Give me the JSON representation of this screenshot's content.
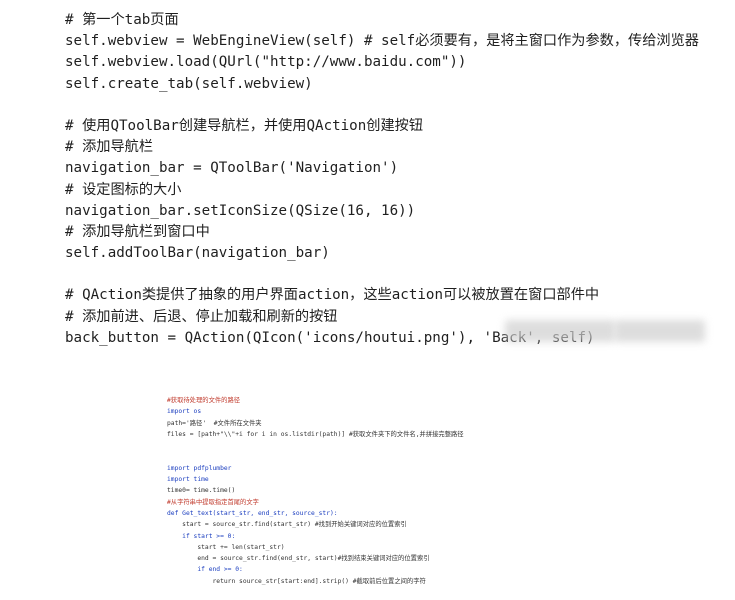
{
  "main_code": [
    "# 第一个tab页面",
    "self.webview = WebEngineView(self) # self必须要有，是将主窗口作为参数，传给浏览器",
    "self.webview.load(QUrl(\"http://www.baidu.com\"))",
    "self.create_tab(self.webview)",
    "",
    "# 使用QToolBar创建导航栏，并使用QAction创建按钮",
    "# 添加导航栏",
    "navigation_bar = QToolBar('Navigation')",
    "# 设定图标的大小",
    "navigation_bar.setIconSize(QSize(16, 16))",
    "# 添加导航栏到窗口中",
    "self.addToolBar(navigation_bar)",
    "",
    "# QAction类提供了抽象的用户界面action，这些action可以被放置在窗口部件中",
    "# 添加前进、后退、停止加载和刷新的按钮",
    "back_button = QAction(QIcon('icons/houtui.png'), 'Back', self)"
  ],
  "thumb_code": [
    "#获取待处理的文件的路径",
    "import os",
    "path='路径'  #文件所在文件夹",
    "files = [path+\"\\\\\"+i for i in os.listdir(path)] #获取文件夹下的文件名,并拼接完整路径",
    "",
    "",
    "import pdfplumber",
    "import time",
    "time0= time.time()",
    "#从字符串中提取指定首尾的文字",
    "def Get_text(start_str, end_str, source_str):",
    "    start = source_str.find(start_str) #找到开始关键词对应的位置索引",
    "    if start >= 0:",
    "        start += len(start_str)",
    "        end = source_str.find(end_str, start)#找到结束关键词对应的位置索引",
    "        if end >= 0:",
    "            return source_str[start:end].strip() #截取前后位置之间的字符"
  ]
}
